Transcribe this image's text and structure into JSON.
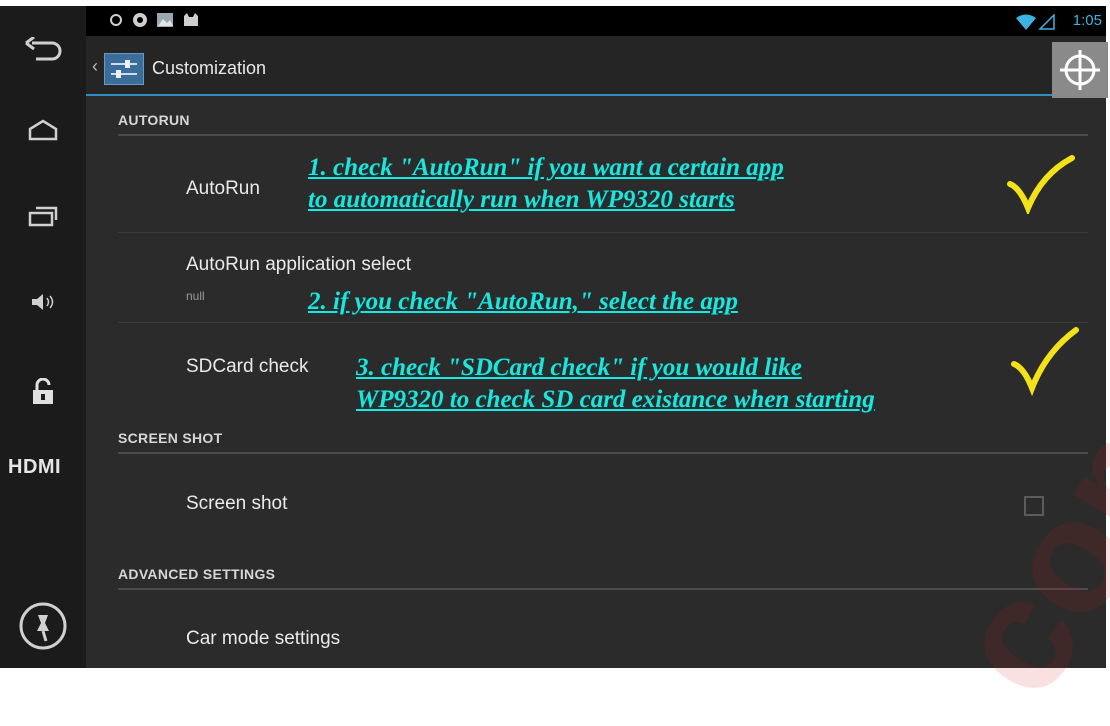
{
  "action_bar": {
    "title": "Customization"
  },
  "status_bar": {
    "time": "1:05"
  },
  "rail": {
    "hdmi_label": "HDMI"
  },
  "sections": [
    {
      "header": "AUTORUN",
      "items": [
        {
          "label": "AutoRun"
        },
        {
          "label": "AutoRun application select",
          "summary": "null"
        },
        {
          "label": "SDCard check"
        }
      ]
    },
    {
      "header": "SCREEN SHOT",
      "items": [
        {
          "label": "Screen shot",
          "checked": false
        }
      ]
    },
    {
      "header": "ADVANCED SETTINGS",
      "items": [
        {
          "label": "Car mode settings"
        }
      ]
    }
  ],
  "annotations": [
    {
      "line1": "1. check \"AutoRun\" if you want a certain app",
      "line2": "to automatically run when WP9320 starts"
    },
    {
      "line1": "2. if you check \"AutoRun,\" select the app"
    },
    {
      "line1": "3. check \"SDCard check\" if you would like",
      "line2": "WP9320 to check SD card existance when starting"
    }
  ],
  "watermark": "com",
  "colors": {
    "annotation": "#22e3d8",
    "checkmark": "#f3e21a",
    "accent": "#2e8ec2"
  }
}
